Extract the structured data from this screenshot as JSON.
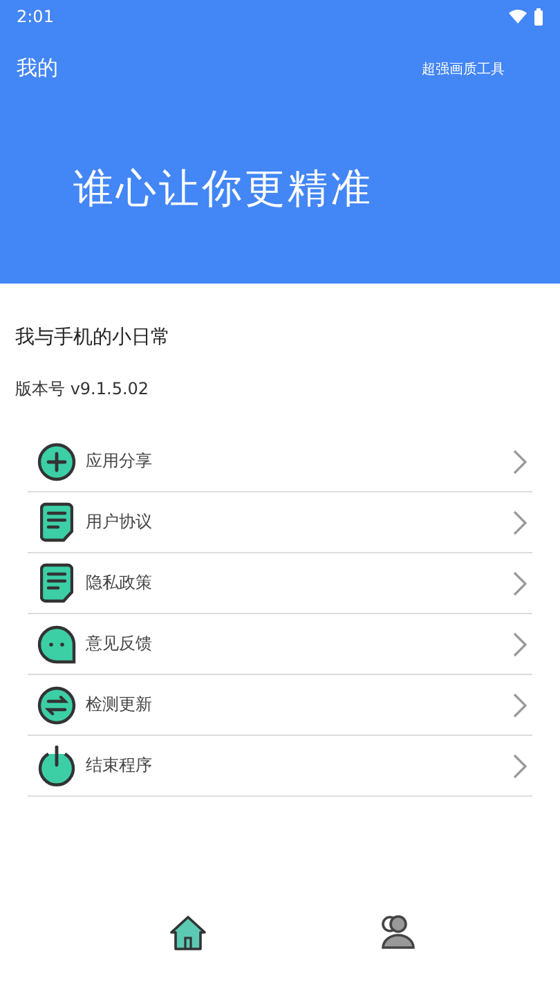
{
  "status_bar": {
    "time": "2:01"
  },
  "header": {
    "title": "我的",
    "action": "超强画质工具",
    "slogan": "谁心让你更精准"
  },
  "profile": {
    "name": "我与手机的小日常",
    "version": "版本号 v9.1.5.02"
  },
  "menu": [
    {
      "kind": "plus",
      "label": "应用分享"
    },
    {
      "kind": "document",
      "label": "用户协议"
    },
    {
      "kind": "document",
      "label": "隐私政策"
    },
    {
      "kind": "chat",
      "label": "意见反馈"
    },
    {
      "kind": "swap",
      "label": "检测更新"
    },
    {
      "kind": "power",
      "label": "结束程序"
    }
  ],
  "nav": [
    {
      "kind": "home",
      "selected": true
    },
    {
      "kind": "people",
      "selected": false
    }
  ]
}
